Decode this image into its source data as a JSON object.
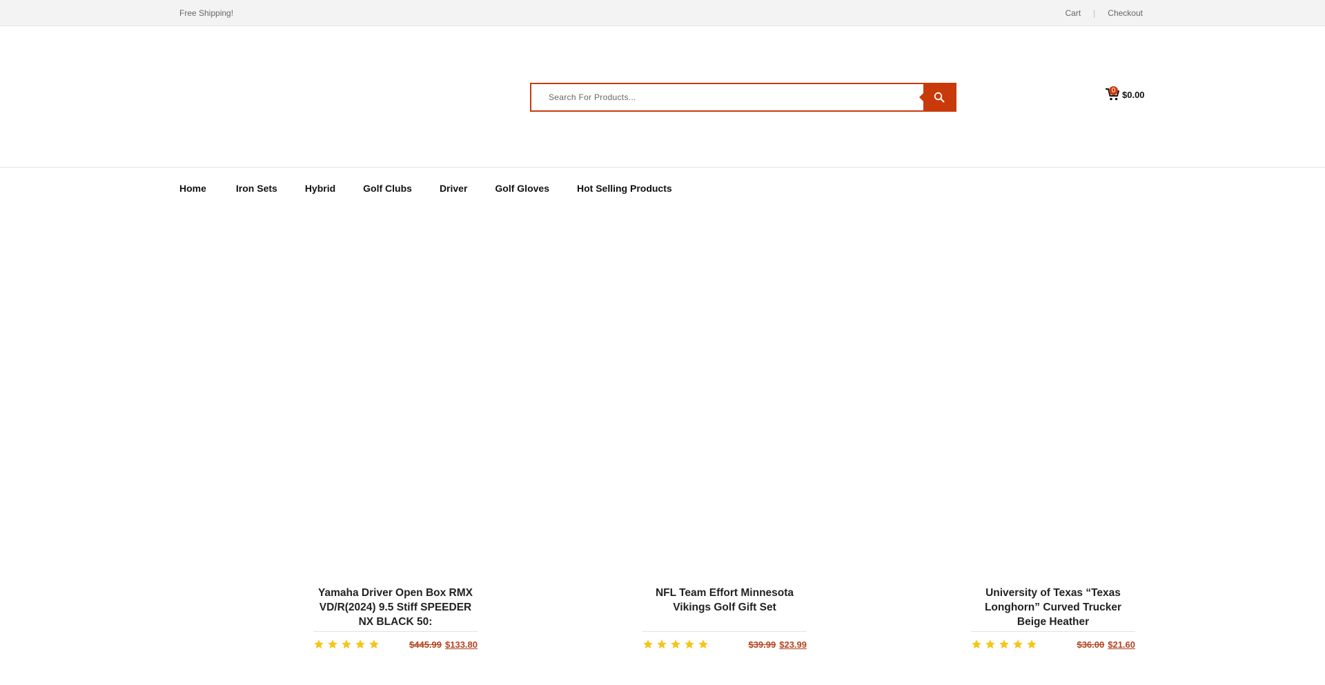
{
  "topbar": {
    "shipping_text": "Free Shipping!",
    "cart_link": "Cart",
    "separator": "|",
    "checkout_link": "Checkout"
  },
  "search": {
    "placeholder": "Search For Products...",
    "button_icon": "search-icon"
  },
  "cart": {
    "count": "0",
    "total": "$0.00",
    "icon": "cart-icon"
  },
  "nav": {
    "items": [
      "Home",
      "Iron Sets",
      "Hybrid",
      "Golf Clubs",
      "Driver",
      "Golf Gloves",
      "Hot Selling Products"
    ]
  },
  "products": [
    {
      "title": "Yamaha Driver Open Box RMX VD/R(2024) 9.5 Stiff SPEEDER NX BLACK 50:",
      "rating": 5,
      "old_price": "$445.99",
      "new_price": "$133.80"
    },
    {
      "title": "NFL Team Effort Minnesota Vikings Golf Gift Set",
      "rating": 5,
      "old_price": "$39.99",
      "new_price": "$23.99"
    },
    {
      "title": "University of Texas “Texas Longhorn” Curved Trucker Beige Heather",
      "rating": 5,
      "old_price": "$36.00",
      "new_price": "$21.60"
    }
  ],
  "colors": {
    "accent": "#c93a0a",
    "price": "#b5411d",
    "star": "#f5c518"
  }
}
